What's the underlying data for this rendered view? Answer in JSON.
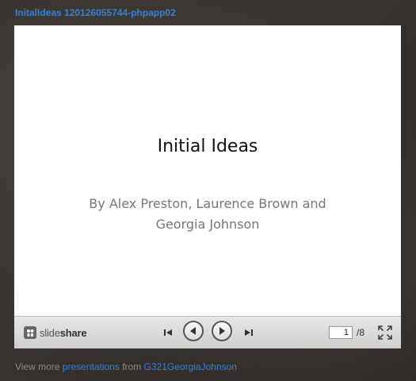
{
  "header": {
    "title": "InitalIdeas 120126055744-phpapp02"
  },
  "slide": {
    "title": "Initial Ideas",
    "subtitle_line1": "By Alex Preston, Laurence Brown and",
    "subtitle_line2": "Georgia Johnson"
  },
  "toolbar": {
    "brand_prefix": "slide",
    "brand_suffix": "share",
    "current_page": "1",
    "total_pages": "/8",
    "icons": [
      "slideshare-logo-icon",
      "first-slide-icon",
      "previous-slide-icon",
      "next-slide-icon",
      "last-slide-icon",
      "fullscreen-icon"
    ]
  },
  "footer": {
    "prefix": "View more",
    "presentations_link": "presentations",
    "from_text": "from",
    "author_link": "G321GeorgiaJohnson"
  },
  "colors": {
    "link": "#3a7fd0",
    "toolbar": "#dcdcdc",
    "slide_background": "#ffffff"
  }
}
